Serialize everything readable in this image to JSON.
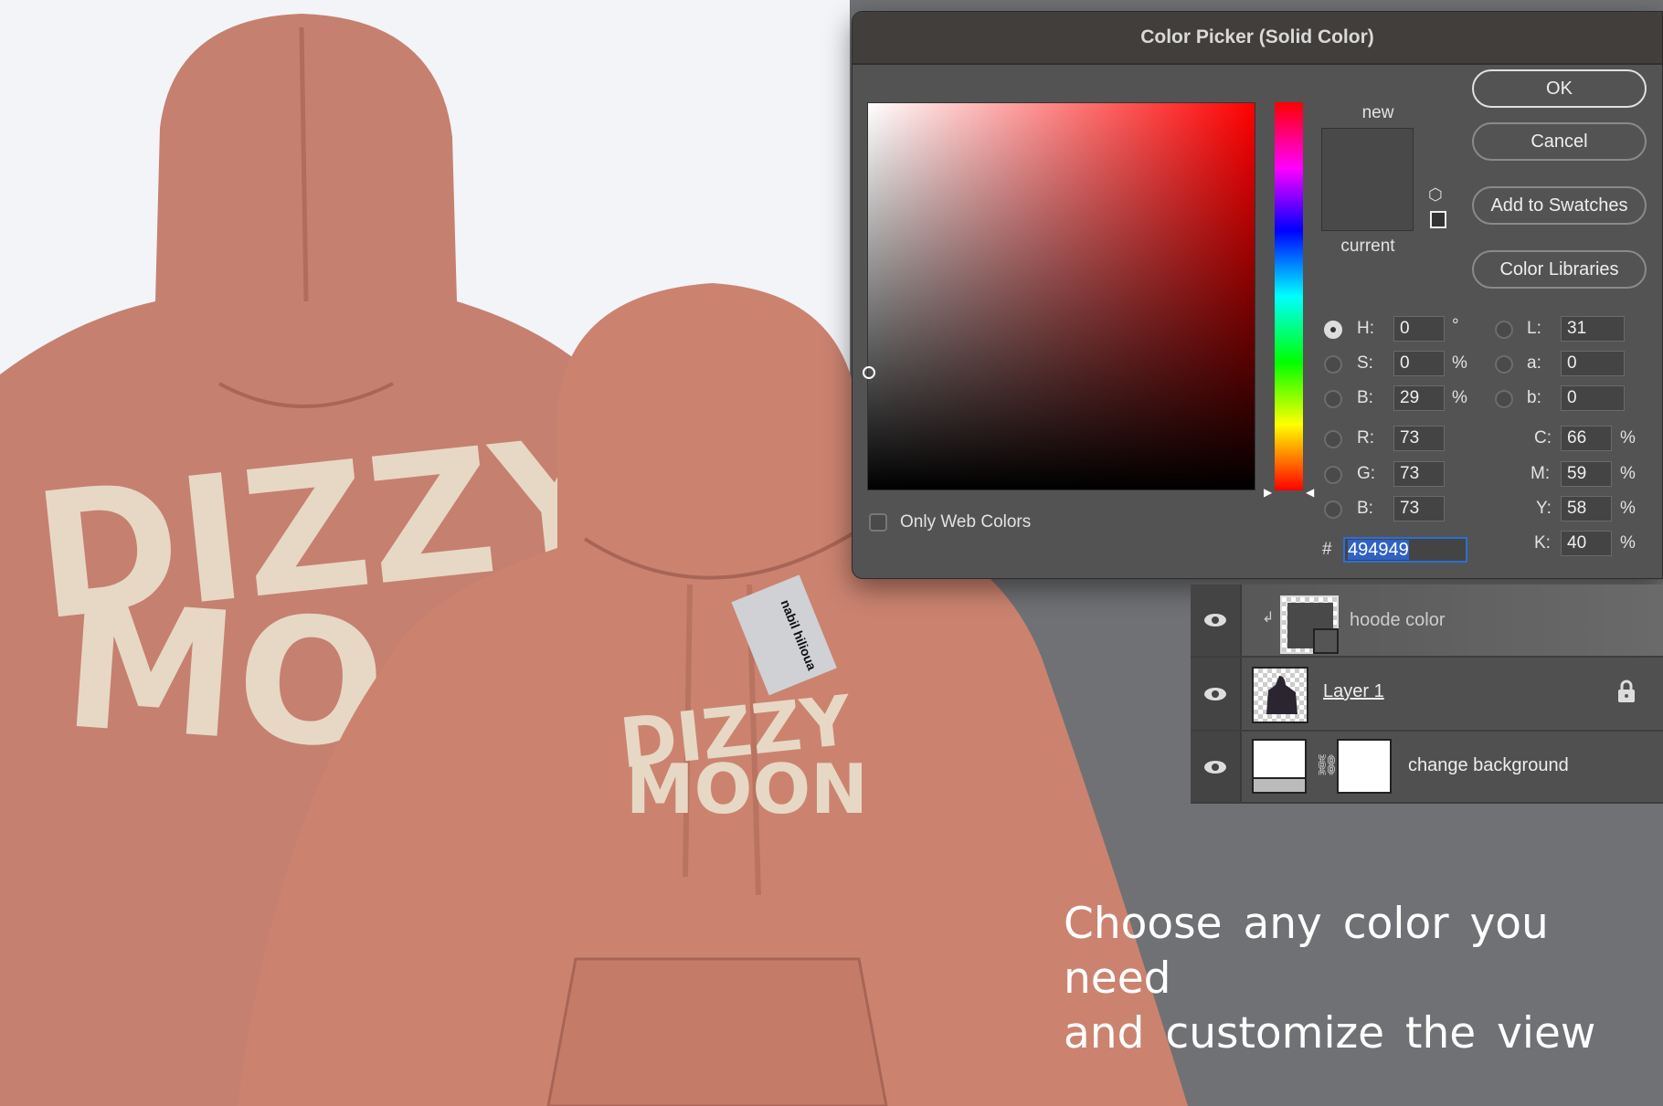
{
  "dialog": {
    "title": "Color Picker (Solid Color)",
    "new_label": "new",
    "current_label": "current",
    "buttons": {
      "ok": "OK",
      "cancel": "Cancel",
      "add_swatches": "Add to Swatches",
      "color_libraries": "Color Libraries"
    },
    "only_web_colors": "Only Web Colors",
    "only_web_colors_checked": false,
    "selected_mode": "H",
    "hsb": [
      {
        "label": "H:",
        "value": "0",
        "unit": "°"
      },
      {
        "label": "S:",
        "value": "0",
        "unit": "%"
      },
      {
        "label": "B:",
        "value": "29",
        "unit": "%"
      }
    ],
    "rgb": [
      {
        "label": "R:",
        "value": "73"
      },
      {
        "label": "G:",
        "value": "73"
      },
      {
        "label": "B:",
        "value": "73"
      }
    ],
    "lab": [
      {
        "label": "L:",
        "value": "31"
      },
      {
        "label": "a:",
        "value": "0"
      },
      {
        "label": "b:",
        "value": "0"
      }
    ],
    "cmyk": [
      {
        "label": "C:",
        "value": "66",
        "unit": "%"
      },
      {
        "label": "M:",
        "value": "59",
        "unit": "%"
      },
      {
        "label": "Y:",
        "value": "58",
        "unit": "%"
      },
      {
        "label": "K:",
        "value": "40",
        "unit": "%"
      }
    ],
    "hex_label": "#",
    "hex_value": "494949",
    "new_color": "#494949",
    "current_color": "#494949"
  },
  "layers": [
    {
      "name": "hoode color",
      "type": "fill-adjustment"
    },
    {
      "name": "Layer 1",
      "locked": true
    },
    {
      "name": "change background",
      "type": "levels-mask"
    }
  ],
  "caption": {
    "line1": "Choose any color you need",
    "line2": "and customize the view"
  },
  "artwork": {
    "print_top": "DIZZY",
    "print_bottom": "MOON",
    "tag_text": "nabil hilioua",
    "hoodie_color": "#c9826f",
    "print_color": "#e6d8c4"
  }
}
